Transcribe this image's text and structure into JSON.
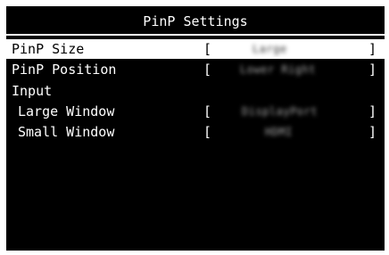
{
  "title": "PinP Settings",
  "rows": [
    {
      "label": "PinP Size",
      "value": "Large",
      "selected": true
    },
    {
      "label": "PinP Position",
      "value": "Lower Right",
      "selected": false
    },
    {
      "label": "Input",
      "value": null,
      "selected": false
    },
    {
      "label": "Large Window",
      "value": "DisplayPort",
      "selected": false
    },
    {
      "label": "Small Window",
      "value": "HDMI",
      "selected": false
    }
  ],
  "bracket_open": "[",
  "bracket_close": "]",
  "colors": {
    "background": "#000000",
    "text": "#ffffff",
    "highlight": "#ffffff",
    "highlight_text": "#000000",
    "page": "#ffffff"
  }
}
